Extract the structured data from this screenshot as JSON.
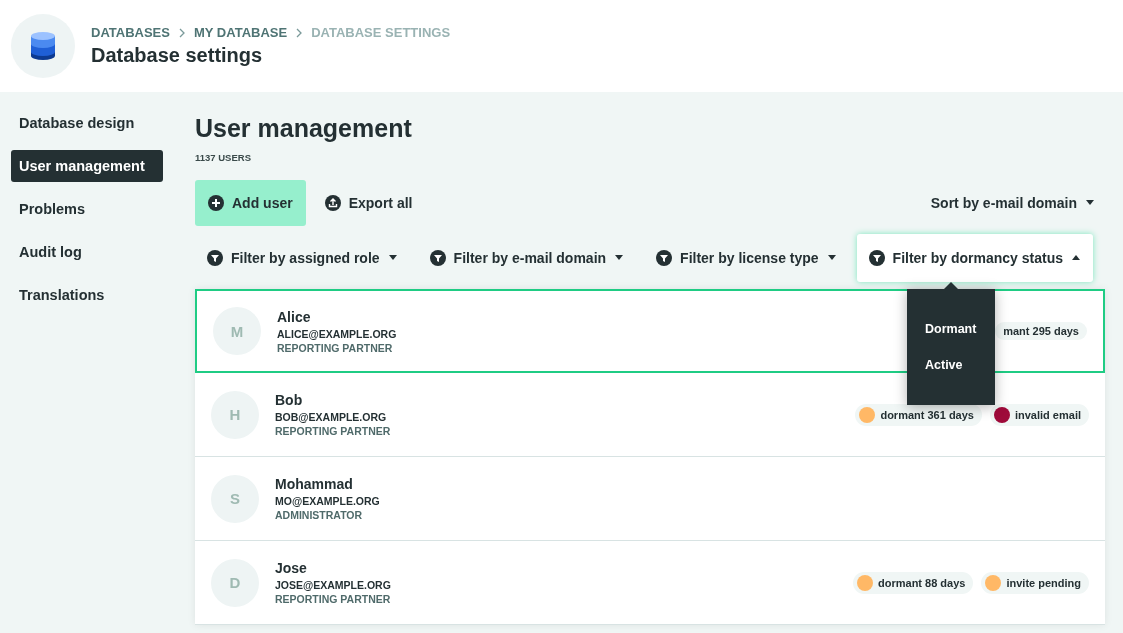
{
  "header": {
    "breadcrumbs": [
      {
        "label": "DATABASES",
        "current": false
      },
      {
        "label": "MY DATABASE",
        "current": false
      },
      {
        "label": "DATABASE SETTINGS",
        "current": true
      }
    ],
    "title": "Database settings"
  },
  "sidebar": {
    "items": [
      {
        "label": "Database design",
        "selected": false
      },
      {
        "label": "User management",
        "selected": true
      },
      {
        "label": "Problems",
        "selected": false
      },
      {
        "label": "Audit log",
        "selected": false
      },
      {
        "label": "Translations",
        "selected": false
      }
    ]
  },
  "page": {
    "title": "User management",
    "count": "1137 USERS"
  },
  "actions": [
    {
      "label": "Add user",
      "kind": "add"
    },
    {
      "label": "Export all",
      "kind": "export"
    }
  ],
  "sort": {
    "label": "Sort by e-mail domain"
  },
  "filters": [
    {
      "label": "Filter by assigned role",
      "expanded": false
    },
    {
      "label": "Filter by e-mail domain",
      "expanded": false
    },
    {
      "label": "Filter by license type",
      "expanded": false
    },
    {
      "label": "Filter by dormancy status",
      "expanded": true
    }
  ],
  "dropdown": {
    "options": [
      "Dormant",
      "Active"
    ]
  },
  "users": [
    {
      "initial": "M",
      "name": "Alice",
      "email": "ALICE@EXAMPLE.ORG",
      "role": "REPORTING PARTNER",
      "selected": true,
      "tags": [
        {
          "label": "mant 295 days"
        }
      ]
    },
    {
      "initial": "H",
      "name": "Bob",
      "email": "BOB@EXAMPLE.ORG",
      "role": "REPORTING PARTNER",
      "selected": false,
      "tags": [
        {
          "label": "dormant 361 days",
          "color": "#ffb866"
        },
        {
          "label": "invalid email",
          "color": "#9e0a3a"
        }
      ]
    },
    {
      "initial": "S",
      "name": "Mohammad",
      "email": "MO@EXAMPLE.ORG",
      "role": "ADMINISTRATOR",
      "selected": false
    },
    {
      "initial": "D",
      "name": "Jose",
      "email": "JOSE@EXAMPLE.ORG",
      "role": "REPORTING PARTNER",
      "selected": false,
      "tags": [
        {
          "label": "dormant 88 days",
          "color": "#ffb866"
        },
        {
          "label": "invite pending",
          "color": "#ffb866"
        }
      ]
    }
  ]
}
